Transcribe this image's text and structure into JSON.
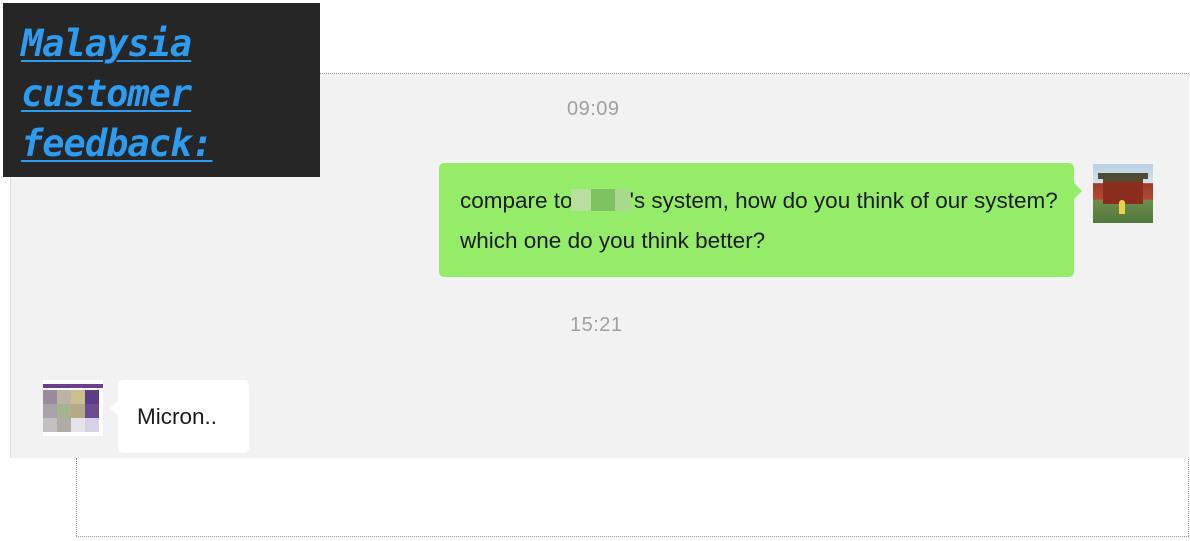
{
  "title": {
    "lines": [
      "Malaysia",
      "customer",
      "feedback:"
    ]
  },
  "chat": {
    "messages": [
      {
        "timestamp": "09:09",
        "direction": "outgoing",
        "text_before": "compare to",
        "text_after": "'s system, how do you think of our system? which one do you think better?",
        "redacted": true
      },
      {
        "timestamp": "15:21",
        "direction": "incoming",
        "text": "Micron.."
      }
    ]
  },
  "colors": {
    "title_background": "#262626",
    "title_text": "#2d9bf0",
    "chat_background": "#f2f2f2",
    "outgoing_bubble": "#95ec69",
    "incoming_bubble": "#ffffff",
    "timestamp_text": "#a0a0a0"
  },
  "icons": {
    "sender_avatar": "avatar-photo-icon",
    "receiver_avatar": "avatar-logo-icon",
    "redaction": "mosaic-blur-icon"
  }
}
